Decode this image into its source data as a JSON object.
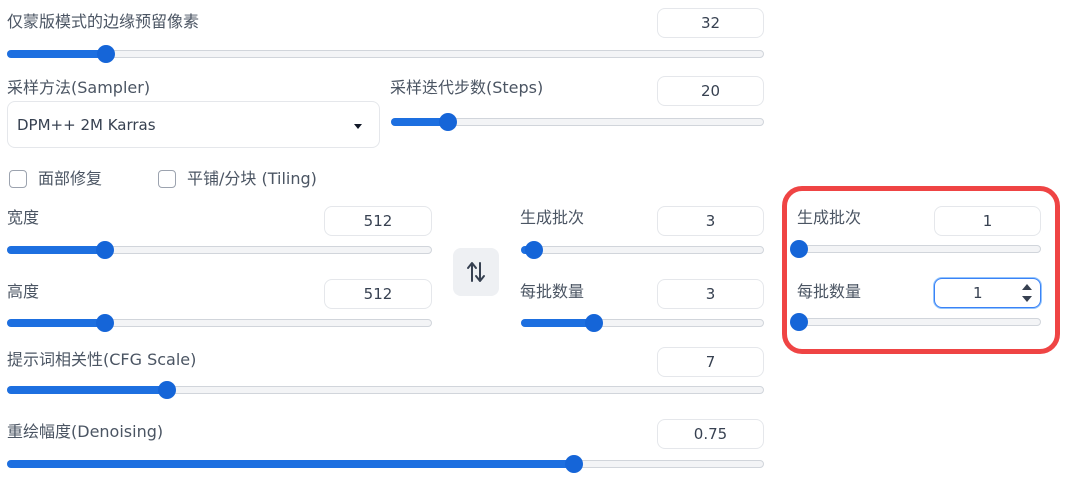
{
  "mask_padding": {
    "label": "仅蒙版模式的边缘预留像素",
    "value": "32",
    "fraction": 0.13
  },
  "sampler": {
    "label": "采样方法(Sampler)",
    "selected": "DPM++ 2M Karras"
  },
  "steps": {
    "label": "采样迭代步数(Steps)",
    "value": "20",
    "fraction": 0.15
  },
  "face_restore": {
    "label": "面部修复",
    "checked": false
  },
  "tiling": {
    "label": "平铺/分块 (Tiling)",
    "checked": false
  },
  "width": {
    "label": "宽度",
    "value": "512",
    "fraction": 0.23
  },
  "height": {
    "label": "高度",
    "value": "512",
    "fraction": 0.23
  },
  "swap_icon": "swap-vertical-arrows-icon",
  "batch_count": {
    "label": "生成批次",
    "value": "3",
    "fraction": 0.05
  },
  "batch_size": {
    "label": "每批数量",
    "value": "3",
    "fraction": 0.3
  },
  "hl_batch_count": {
    "label": "生成批次",
    "value": "1",
    "fraction": 0.0
  },
  "hl_batch_size": {
    "label": "每批数量",
    "value": "1",
    "fraction": 0.0
  },
  "cfg_scale": {
    "label": "提示词相关性(CFG Scale)",
    "value": "7",
    "fraction": 0.21
  },
  "denoising": {
    "label": "重绘幅度(Denoising)",
    "value": "0.75",
    "fraction": 0.75
  },
  "colors": {
    "accent": "#1d6fe0",
    "highlight_border": "#ef4444"
  }
}
